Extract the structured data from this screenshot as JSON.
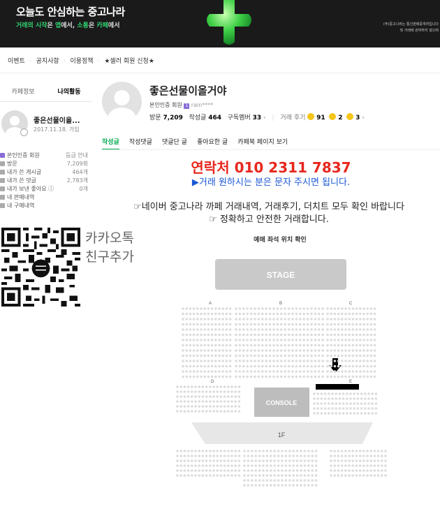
{
  "banner": {
    "title": "오늘도 안심하는 중고나라",
    "sub_parts": [
      "거래의 시작",
      "은 ",
      "앱",
      "에서, ",
      "소통",
      "은 ",
      "카페",
      "에서"
    ],
    "note_lines": [
      "(주)중고나라는 통신판매중개자입니다",
      "및 거래에 관여하지 않으며"
    ]
  },
  "menu": {
    "items": [
      "이벤트",
      "공지사항",
      "이용정책",
      "★셀러 회원 신청★"
    ]
  },
  "sidebar": {
    "tabs": [
      "카페정보",
      "나의활동"
    ],
    "name": "좋은선물이올...",
    "joined": "2017.11.18. 가입",
    "stats": [
      {
        "label": "본인인증 회원",
        "value": "등급 안내"
      },
      {
        "label": "방문",
        "value": "7,209회"
      },
      {
        "label": "내가 쓴 게시글",
        "value": "464개"
      },
      {
        "label": "내가 쓴 댓글",
        "value": "2,783개"
      },
      {
        "label": "내가 보낸 좋아요 ⓘ",
        "value": "0개"
      },
      {
        "label": "내 판매내역",
        "value": ""
      },
      {
        "label": "내 구매내역",
        "value": ""
      }
    ]
  },
  "qr": {
    "text_line1": "카카오톡",
    "text_line2": "친구추가"
  },
  "profile": {
    "name": "좋은선물이올거야",
    "verified": "본인인증 회원",
    "badge": "1",
    "userid": "rain****",
    "visits_label": "방문",
    "visits": "7,209",
    "posts_label": "작성글",
    "posts": "464",
    "members_label": "구독멤버",
    "members": "33",
    "reviews_label": "거래 후기",
    "review_good": "91",
    "review_mid": "2",
    "review_bad": "3"
  },
  "tabs": [
    "작성글",
    "작성댓글",
    "댓글단 글",
    "좋아요한 글",
    "카페북 페이지 보기"
  ],
  "content": {
    "contact": "연락처 010 2311 7837",
    "notice": "▶거래 원하시는 분은 문자 주시면 됩니다.",
    "line1": "☞네이버 중고나라 까페 거래내역, 거래후기, 더치트 모두 확인 바랍니다",
    "line2": "☞ 정확하고 안전한 거래합니다.",
    "map_title": "예매 좌석 위치 확인"
  },
  "seatmap": {
    "stage": "STAGE",
    "console": "CONSOLE",
    "floor": "1F",
    "section_labels": [
      "A",
      "B",
      "C",
      "D",
      "E"
    ],
    "colors": {
      "seat": "#dcdcdc",
      "block": "#c8c8c8",
      "stage_bg": "#c9c9c9",
      "marker": "#000000"
    }
  }
}
